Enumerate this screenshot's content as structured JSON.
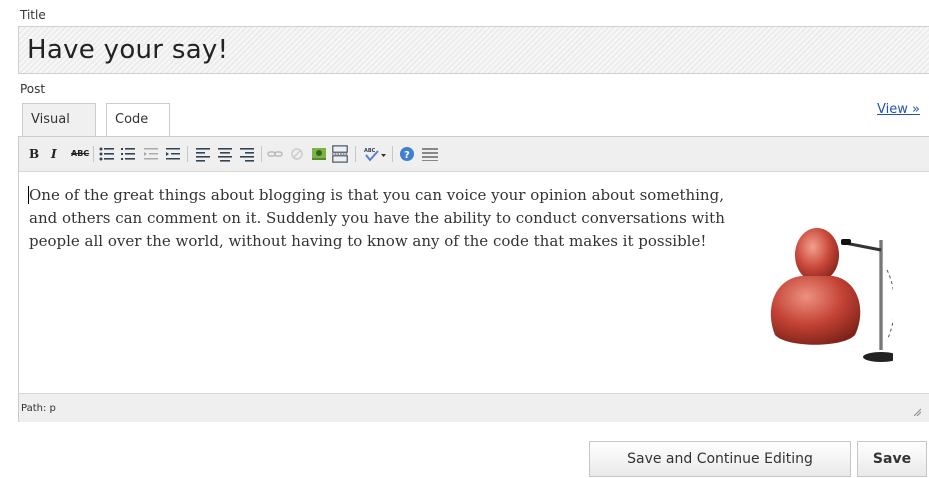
{
  "title_label": "Title",
  "title_value": "Have your say!",
  "post_label": "Post",
  "tabs": [
    {
      "label": "Visual"
    },
    {
      "label": "Code"
    }
  ],
  "view_link": "View »",
  "toolbar": {
    "bold": "B",
    "italic": "I",
    "strike": "ABC",
    "items": [
      "bold-icon",
      "italic-icon",
      "strikethrough-icon",
      "bullet-list-icon",
      "numbered-list-icon",
      "outdent-icon",
      "indent-icon",
      "align-left-icon",
      "align-center-icon",
      "align-right-icon",
      "link-icon",
      "unlink-icon",
      "insert-image-icon",
      "page-break-icon",
      "spellcheck-icon",
      "help-icon",
      "kitchen-sink-icon"
    ]
  },
  "editor_text": "One of the great things about blogging is that you can voice your opinion about something, and others can comment on it. Suddenly you have the ability to conduct conversations with people all over the world, without having to know any of the code that makes it possible!",
  "status_path": "Path: p",
  "buttons": {
    "save_continue": "Save and Continue Editing",
    "save": "Save"
  },
  "colors": {
    "link": "#2255aa",
    "avatar": "#c9483a"
  }
}
